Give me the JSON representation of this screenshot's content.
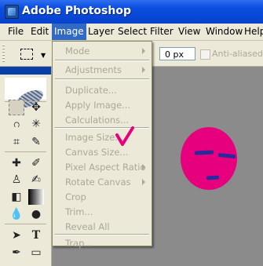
{
  "window": {
    "title": "Adobe Photoshop"
  },
  "menubar": {
    "items": [
      "File",
      "Edit",
      "Image",
      "Layer",
      "Select",
      "Filter",
      "View",
      "Window",
      "Help"
    ],
    "active": "Image"
  },
  "options": {
    "feather_value": "0 px",
    "anti_aliased_label": "Anti-aliased"
  },
  "image_menu": {
    "mode": "Mode",
    "adjustments": "Adjustments",
    "duplicate": "Duplicate...",
    "apply_image": "Apply Image...",
    "calculations": "Calculations...",
    "image_size": "Image Size...",
    "canvas_size": "Canvas Size...",
    "pixel_aspect_ratio": "Pixel Aspect Ratio",
    "rotate_canvas": "Rotate Canvas",
    "crop": "Crop",
    "trim": "Trim...",
    "reveal_all": "Reveal All",
    "trap": "Trap..."
  },
  "colors": {
    "titlebar": "#0a4ee0",
    "menu_highlight": "#316ac5",
    "disabled_text": "#aca899",
    "annotation_check": "#e6007e",
    "circle": "#e6007e",
    "dash": "#2a2a9c"
  },
  "icons": [
    "photoshop-logo-icon",
    "rect-marquee-icon",
    "move-icon",
    "lasso-icon",
    "magic-wand-icon",
    "crop-icon",
    "slice-icon",
    "healing-brush-icon",
    "brush-icon",
    "clone-stamp-icon",
    "history-brush-icon",
    "eraser-icon",
    "gradient-icon",
    "blur-icon",
    "dodge-icon",
    "path-selection-icon",
    "type-icon",
    "pen-icon",
    "rectangle-shape-icon",
    "feather-icon"
  ]
}
